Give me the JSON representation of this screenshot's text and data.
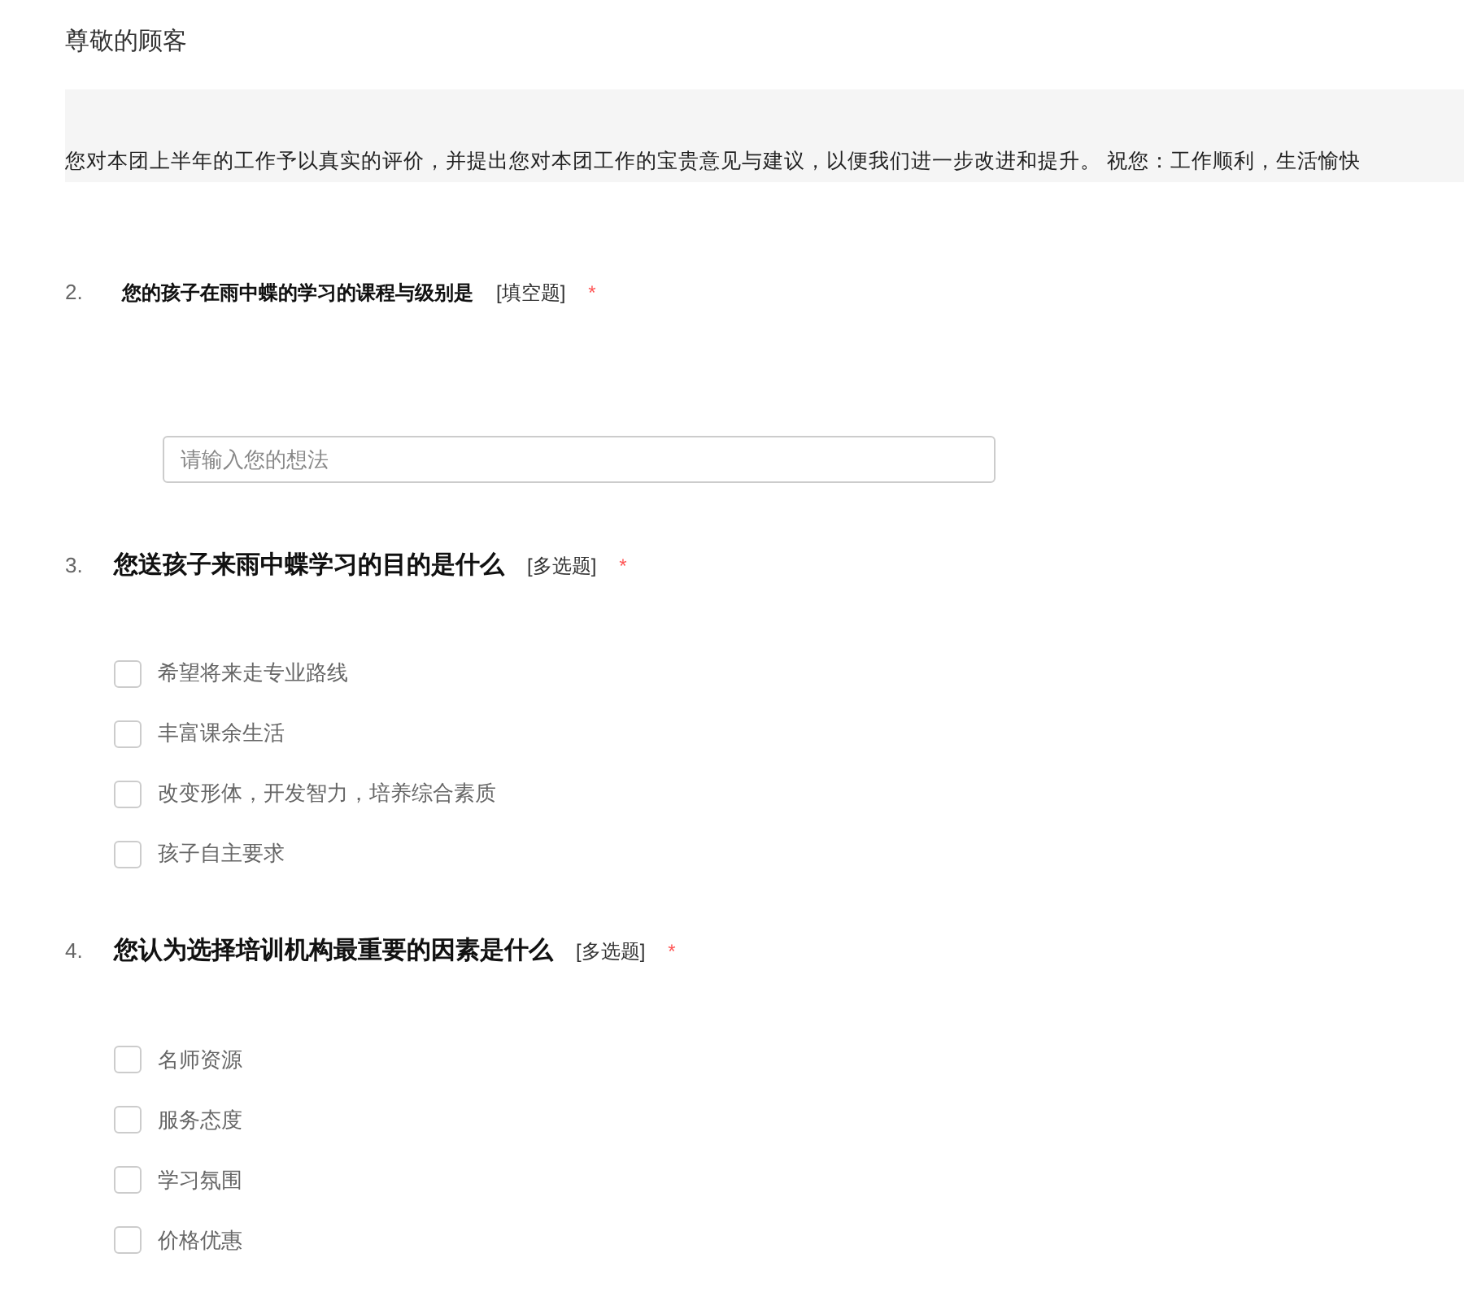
{
  "greeting": "尊敬的顾客",
  "intro": "您对本团上半年的工作予以真实的评价，并提出您对本团工作的宝贵意见与建议，以便我们进一步改进和提升。 祝您：工作顺利，生活愉快",
  "questions": [
    {
      "kind": "text",
      "number": "2.",
      "title": "您的孩子在雨中蝶的学习的课程与级别是",
      "type_label": "[填空题]",
      "required_mark": "*",
      "placeholder": "请输入您的想法"
    },
    {
      "kind": "multi",
      "number": "3.",
      "title": "您送孩子来雨中蝶学习的目的是什么",
      "type_label": "[多选题]",
      "required_mark": "*",
      "options": [
        {
          "label": "希望将来走专业路线",
          "checked": false
        },
        {
          "label": "丰富课余生活",
          "checked": false
        },
        {
          "label": "改变形体，开发智力，培养综合素质",
          "checked": false
        },
        {
          "label": "孩子自主要求",
          "checked": false
        }
      ]
    },
    {
      "kind": "multi",
      "number": "4.",
      "title": "您认为选择培训机构最重要的因素是什么",
      "type_label": "[多选题]",
      "required_mark": "*",
      "options": [
        {
          "label": "名师资源",
          "checked": false
        },
        {
          "label": "服务态度",
          "checked": false
        },
        {
          "label": "学习氛围",
          "checked": false
        },
        {
          "label": "价格优惠",
          "checked": false
        }
      ]
    }
  ]
}
